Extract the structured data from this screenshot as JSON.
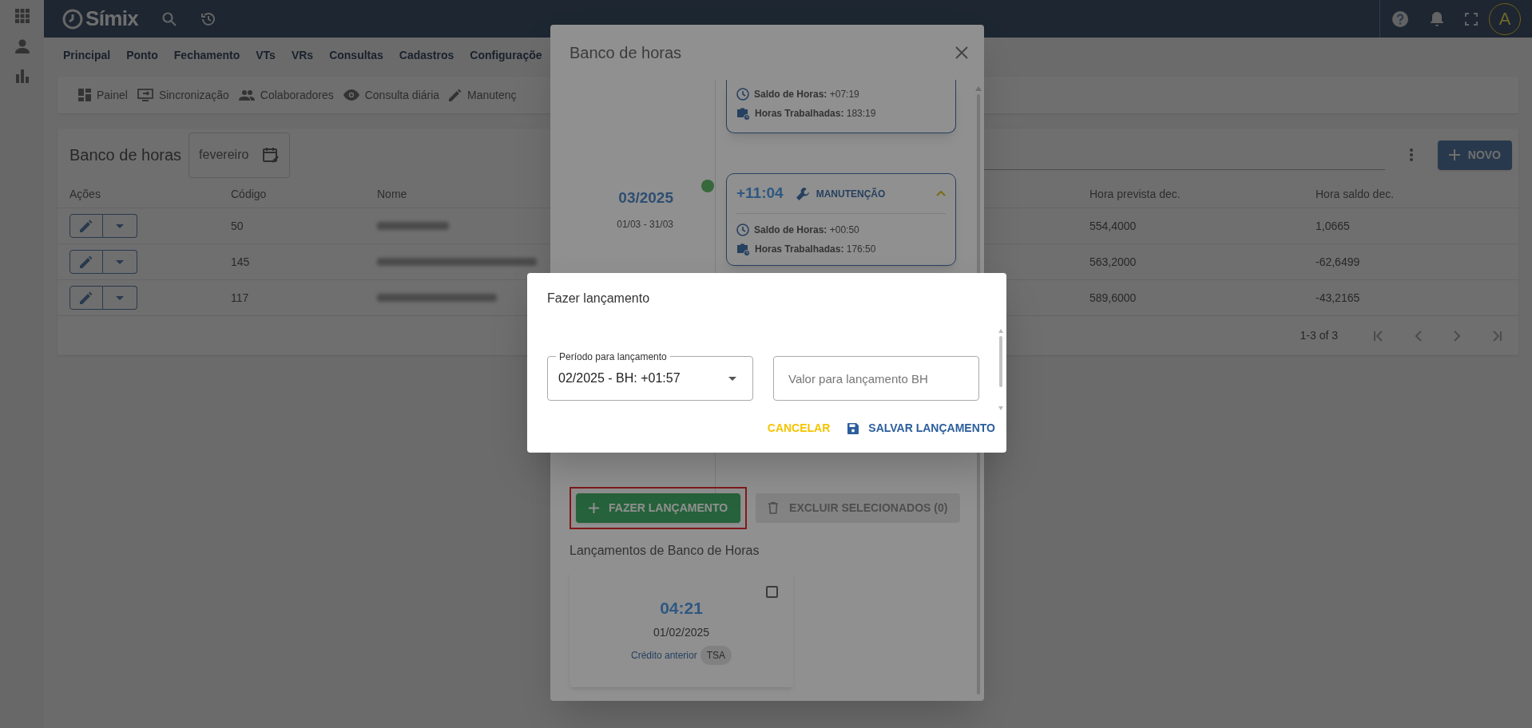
{
  "app_bar": {
    "logo": "Símix",
    "avatar": "A"
  },
  "menu": {
    "items": [
      {
        "label": "Principal"
      },
      {
        "label": "Ponto"
      },
      {
        "label": "Fechamento"
      },
      {
        "label": "VTs"
      },
      {
        "label": "VRs"
      },
      {
        "label": "Consultas"
      },
      {
        "label": "Cadastros"
      },
      {
        "label": "Configuraçõe"
      }
    ]
  },
  "toolbar": {
    "items": [
      {
        "label": "Painel"
      },
      {
        "label": "Sincronização"
      },
      {
        "label": "Colaboradores"
      },
      {
        "label": "Consulta diária"
      },
      {
        "label": "Manutenç"
      }
    ]
  },
  "page": {
    "title": "Banco de horas",
    "month_field": "fevereiro",
    "new_button": "NOVO",
    "table": {
      "columns": [
        "Ações",
        "Código",
        "Nome",
        "Hora prevista dec.",
        "Hora saldo dec."
      ],
      "rows": [
        {
          "codigo": "50",
          "prevista": "554,4000",
          "saldo": "1,0665"
        },
        {
          "codigo": "145",
          "prevista": "563,2000",
          "saldo": "-62,6499"
        },
        {
          "codigo": "117",
          "prevista": "589,6000",
          "saldo": "-43,2165"
        }
      ]
    },
    "pagination": "1-3 of 3"
  },
  "modal": {
    "title": "Banco de horas",
    "periods": [
      {
        "kind": "partial",
        "saldo": "**Saldo de Horas:** +07:19",
        "trabalhadas": "**Horas Trabalhadas:** 183:19"
      },
      {
        "kind": "full",
        "period": "03/2025",
        "range": "01/03 - 31/03",
        "color": "#366839",
        "total": "+11:04",
        "tag": "MANUTENÇÃO",
        "expanded": true,
        "saldo": "**Saldo de Horas:** +00:50",
        "trabalhadas": "**Horas Trabalhadas:** 176:50"
      }
    ],
    "add_button": {
      "label": "FAZER LANÇAMENTO",
      "highlighted": true
    },
    "delete_button": {
      "label": "EXCLUIR SELECIONADOS (0)",
      "disabled": true
    },
    "entries_title": "Lançamentos de Banco de Horas",
    "entries": [
      {
        "value": "04:21",
        "date": "01/02/2025",
        "type": "Crédito anterior",
        "tag": "TSA",
        "checked": false
      }
    ]
  },
  "dialog": {
    "title": "Fazer lançamento",
    "period_field": {
      "label": "Período para lançamento",
      "value": "02/2025 - BH: +01:57"
    },
    "value_field": {
      "placeholder": "Valor para lançamento BH"
    },
    "cancel": "CANCELAR",
    "save": "SALVAR LANÇAMENTO"
  }
}
